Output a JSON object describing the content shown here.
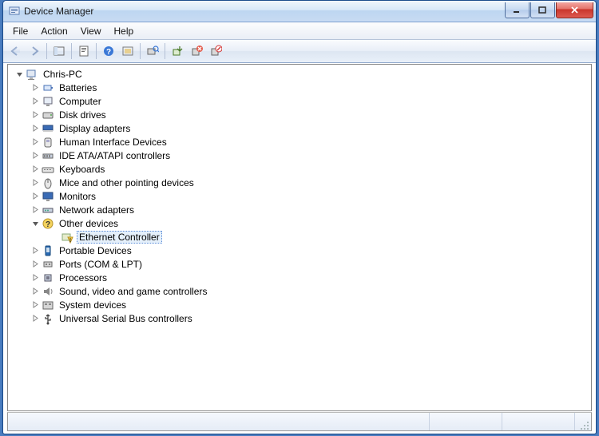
{
  "window": {
    "title": "Device Manager"
  },
  "menu": {
    "file": "File",
    "action": "Action",
    "view": "View",
    "help": "Help"
  },
  "tree": {
    "root": "Chris-PC",
    "nodes": [
      {
        "label": "Batteries"
      },
      {
        "label": "Computer"
      },
      {
        "label": "Disk drives"
      },
      {
        "label": "Display adapters"
      },
      {
        "label": "Human Interface Devices"
      },
      {
        "label": "IDE ATA/ATAPI controllers"
      },
      {
        "label": "Keyboards"
      },
      {
        "label": "Mice and other pointing devices"
      },
      {
        "label": "Monitors"
      },
      {
        "label": "Network adapters"
      },
      {
        "label": "Other devices",
        "expanded": true,
        "children": [
          {
            "label": "Ethernet Controller",
            "warning": true,
            "selected": true
          }
        ]
      },
      {
        "label": "Portable Devices"
      },
      {
        "label": "Ports (COM & LPT)"
      },
      {
        "label": "Processors"
      },
      {
        "label": "Sound, video and game controllers"
      },
      {
        "label": "System devices"
      },
      {
        "label": "Universal Serial Bus controllers"
      }
    ]
  }
}
